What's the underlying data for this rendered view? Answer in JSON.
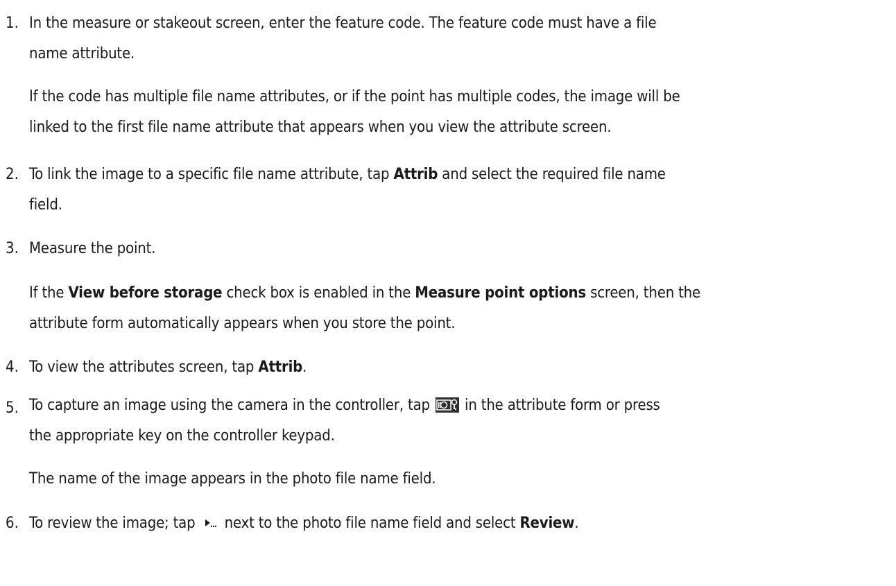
{
  "steps": [
    {
      "num": "1.",
      "lines": [
        "In the measure or stakeout screen, enter the feature code. The feature code must have a file",
        "name attribute."
      ],
      "note": [
        "If the code has multiple file name attributes, or if the point has multiple codes, the image will be",
        "linked to the first file name attribute that appears when you view the attribute screen."
      ]
    },
    {
      "num": "2.",
      "l1_a": "To link the image to a specific file name attribute, tap ",
      "l1_b": "Attrib",
      "l1_c": " and select the required file name",
      "l2": "field."
    },
    {
      "num": "3.",
      "l1": "Measure the point.",
      "note1_a": "If the ",
      "note1_b": "View before storage",
      "note1_c": " check box is enabled in the ",
      "note1_d": "Measure point options",
      "note1_e": " screen, then the",
      "note2": "attribute form automatically appears when you store the point."
    },
    {
      "num": "4.",
      "l1_a": "To view the attributes screen, tap ",
      "l1_b": "Attrib",
      "l1_c": "."
    },
    {
      "num": "5.",
      "l1_a": "To capture an image using the camera in the controller, tap ",
      "l1_icon": "camera-icon",
      "l1_c": " in the attribute form or press",
      "l2": "the appropriate key on the controller keypad.",
      "note": "The name of the image appears in the photo file name field."
    },
    {
      "num": "6.",
      "l1_a": "To review the image; tap ",
      "l1_icon": "menu-arrow-icon",
      "l1_c": " next to the photo file name field and select ",
      "l1_d": "Review",
      "l1_e": "."
    }
  ]
}
